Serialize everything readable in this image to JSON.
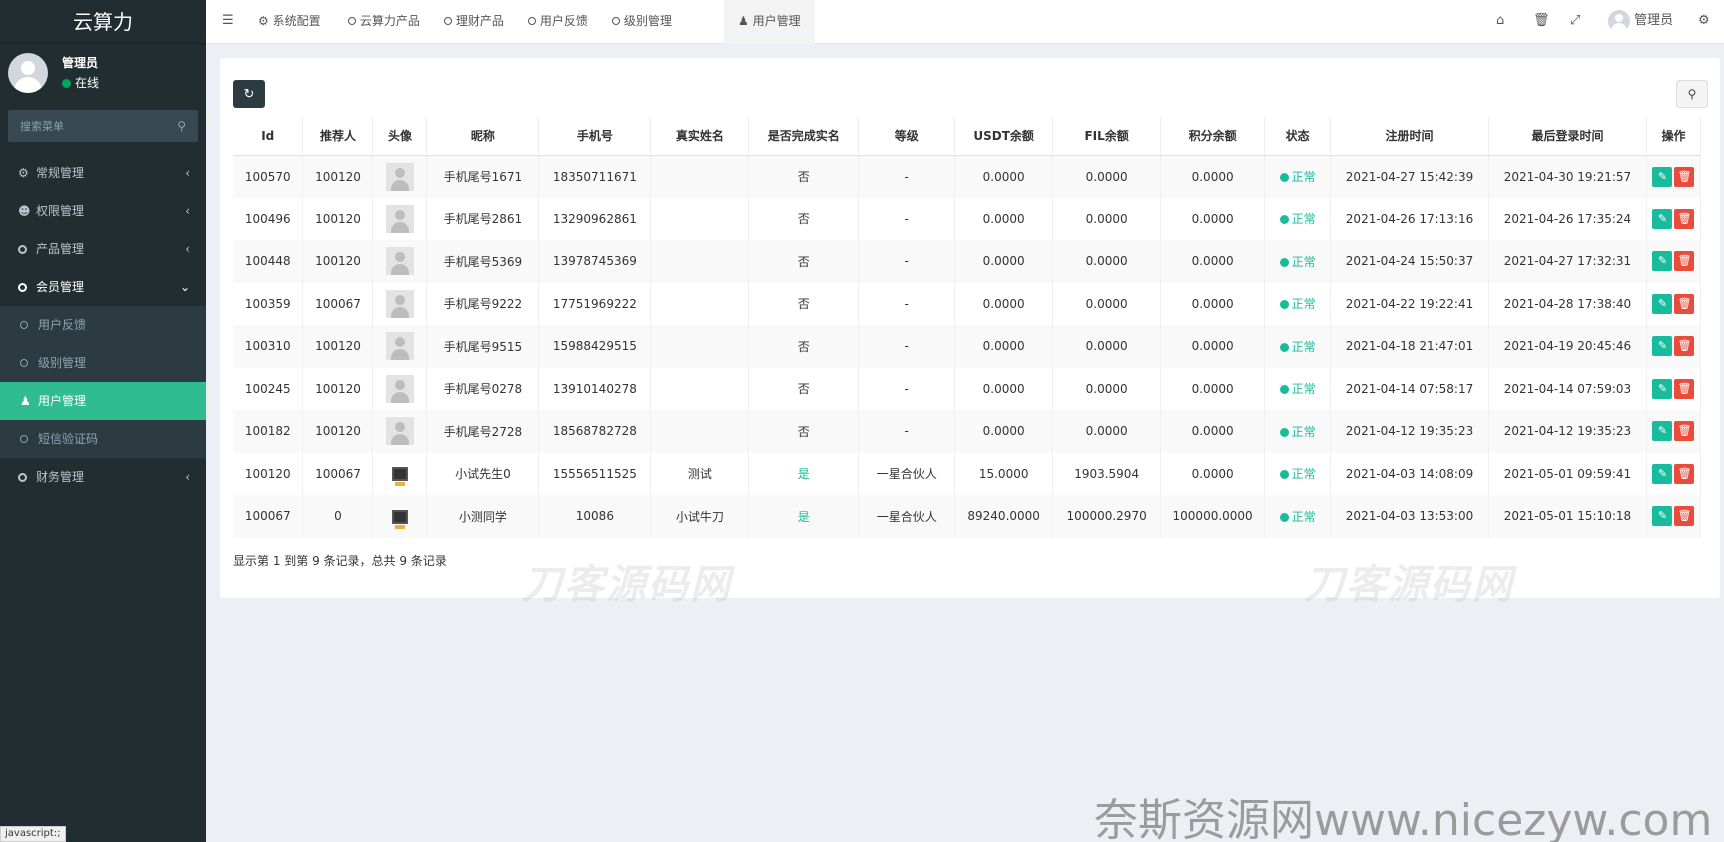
{
  "app": {
    "logo": "云算力",
    "user_name": "管理员",
    "user_status": "在线",
    "search_placeholder": "搜索菜单"
  },
  "menu": {
    "general": "常规管理",
    "auth": "权限管理",
    "product": "产品管理",
    "member": "会员管理",
    "sub": {
      "feedback": "用户反馈",
      "level": "级别管理",
      "users": "用户管理",
      "sms": "短信验证码"
    },
    "finance": "财务管理"
  },
  "topbar": {
    "tabs": [
      "系统配置",
      "云算力产品",
      "理财产品",
      "用户反馈",
      "级别管理",
      "用户管理"
    ],
    "admin_label": "管理员"
  },
  "table": {
    "headers": [
      "Id",
      "推荐人",
      "头像",
      "昵称",
      "手机号",
      "真实姓名",
      "是否完成实名",
      "等级",
      "USDT余额",
      "FIL余额",
      "积分余额",
      "状态",
      "注册时间",
      "最后登录时间",
      "操作"
    ],
    "rows": [
      {
        "id": "100570",
        "ref": "100120",
        "avatar": "default",
        "nick": "手机尾号1671",
        "phone": "18350711671",
        "real": "",
        "verified": "否",
        "level": "-",
        "usdt": "0.0000",
        "fil": "0.0000",
        "points": "0.0000",
        "status": "正常",
        "reg": "2021-04-27 15:42:39",
        "login": "2021-04-30 19:21:57"
      },
      {
        "id": "100496",
        "ref": "100120",
        "avatar": "default",
        "nick": "手机尾号2861",
        "phone": "13290962861",
        "real": "",
        "verified": "否",
        "level": "-",
        "usdt": "0.0000",
        "fil": "0.0000",
        "points": "0.0000",
        "status": "正常",
        "reg": "2021-04-26 17:13:16",
        "login": "2021-04-26 17:35:24"
      },
      {
        "id": "100448",
        "ref": "100120",
        "avatar": "default",
        "nick": "手机尾号5369",
        "phone": "13978745369",
        "real": "",
        "verified": "否",
        "level": "-",
        "usdt": "0.0000",
        "fil": "0.0000",
        "points": "0.0000",
        "status": "正常",
        "reg": "2021-04-24 15:50:37",
        "login": "2021-04-27 17:32:31"
      },
      {
        "id": "100359",
        "ref": "100067",
        "avatar": "default",
        "nick": "手机尾号9222",
        "phone": "17751969222",
        "real": "",
        "verified": "否",
        "level": "-",
        "usdt": "0.0000",
        "fil": "0.0000",
        "points": "0.0000",
        "status": "正常",
        "reg": "2021-04-22 19:22:41",
        "login": "2021-04-28 17:38:40"
      },
      {
        "id": "100310",
        "ref": "100120",
        "avatar": "default",
        "nick": "手机尾号9515",
        "phone": "15988429515",
        "real": "",
        "verified": "否",
        "level": "-",
        "usdt": "0.0000",
        "fil": "0.0000",
        "points": "0.0000",
        "status": "正常",
        "reg": "2021-04-18 21:47:01",
        "login": "2021-04-19 20:45:46"
      },
      {
        "id": "100245",
        "ref": "100120",
        "avatar": "default",
        "nick": "手机尾号0278",
        "phone": "13910140278",
        "real": "",
        "verified": "否",
        "level": "-",
        "usdt": "0.0000",
        "fil": "0.0000",
        "points": "0.0000",
        "status": "正常",
        "reg": "2021-04-14 07:58:17",
        "login": "2021-04-14 07:59:03"
      },
      {
        "id": "100182",
        "ref": "100120",
        "avatar": "default",
        "nick": "手机尾号2728",
        "phone": "18568782728",
        "real": "",
        "verified": "否",
        "level": "-",
        "usdt": "0.0000",
        "fil": "0.0000",
        "points": "0.0000",
        "status": "正常",
        "reg": "2021-04-12 19:35:23",
        "login": "2021-04-12 19:35:23"
      },
      {
        "id": "100120",
        "ref": "100067",
        "avatar": "pc",
        "nick": "小试先生0",
        "phone": "15556511525",
        "real": "测试",
        "verified": "是",
        "level": "一星合伙人",
        "usdt": "15.0000",
        "fil": "1903.5904",
        "points": "0.0000",
        "status": "正常",
        "reg": "2021-04-03 14:08:09",
        "login": "2021-05-01 09:59:41"
      },
      {
        "id": "100067",
        "ref": "0",
        "avatar": "pc",
        "nick": "小测同学",
        "phone": "10086",
        "real": "小试牛刀",
        "verified": "是",
        "level": "一星合伙人",
        "usdt": "89240.0000",
        "fil": "100000.2970",
        "points": "100000.0000",
        "status": "正常",
        "reg": "2021-04-03 13:53:00",
        "login": "2021-05-01 15:10:18"
      }
    ]
  },
  "pager_text": "显示第 1 到第 9 条记录，总共 9 条记录",
  "watermarks": {
    "w1": "刀客源码网",
    "w2": "刀客源码网",
    "w3": "奈斯资源网www.nicezyw.com"
  },
  "statusbar": "javascript:;",
  "colors": {
    "sidebar_bg": "#222d32",
    "accent": "#2fbd8f",
    "edit": "#18bc9c",
    "delete": "#e74c3c"
  }
}
